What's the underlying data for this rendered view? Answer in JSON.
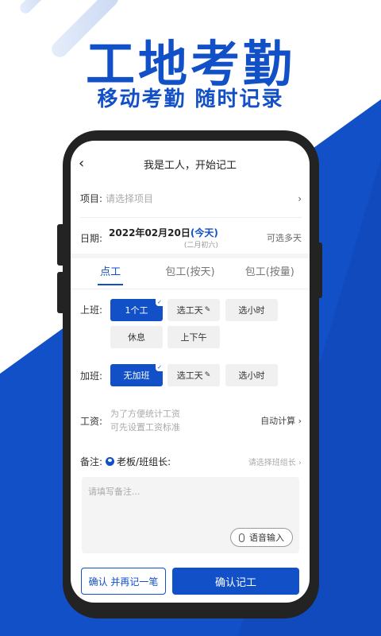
{
  "headline": {
    "title": "工地考勤",
    "subtitle": "移动考勤 随时记录"
  },
  "nav": {
    "title": "我是工人，开始记工"
  },
  "project": {
    "label": "项目:",
    "placeholder": "请选择项目"
  },
  "date": {
    "label": "日期:",
    "value": "2022年02月20日",
    "today": "(今天)",
    "lunar": "(二月初六)",
    "multi": "可选多天"
  },
  "tabs": [
    "点工",
    "包工(按天)",
    "包工(按量)"
  ],
  "shift": {
    "label": "上班:",
    "options": [
      "1个工",
      "选工天",
      "选小时",
      "休息",
      "上下午"
    ],
    "selected": "1个工"
  },
  "overtime": {
    "label": "加班:",
    "options": [
      "无加班",
      "选工天",
      "选小时"
    ],
    "selected": "无加班"
  },
  "wage": {
    "label": "工资:",
    "hint_line1": "为了方便统计工资",
    "hint_line2": "可先设置工资标准",
    "action": "自动计算"
  },
  "remark": {
    "label": "备注:",
    "boss": "老板/班组长:",
    "select": "请选择班组长",
    "placeholder": "请填写备注...",
    "voice": "语音输入"
  },
  "buttons": {
    "confirm_again": "确认 并再记一笔",
    "confirm": "确认记工"
  },
  "colors": {
    "accent": "#1250c8",
    "phone": "#232323"
  }
}
